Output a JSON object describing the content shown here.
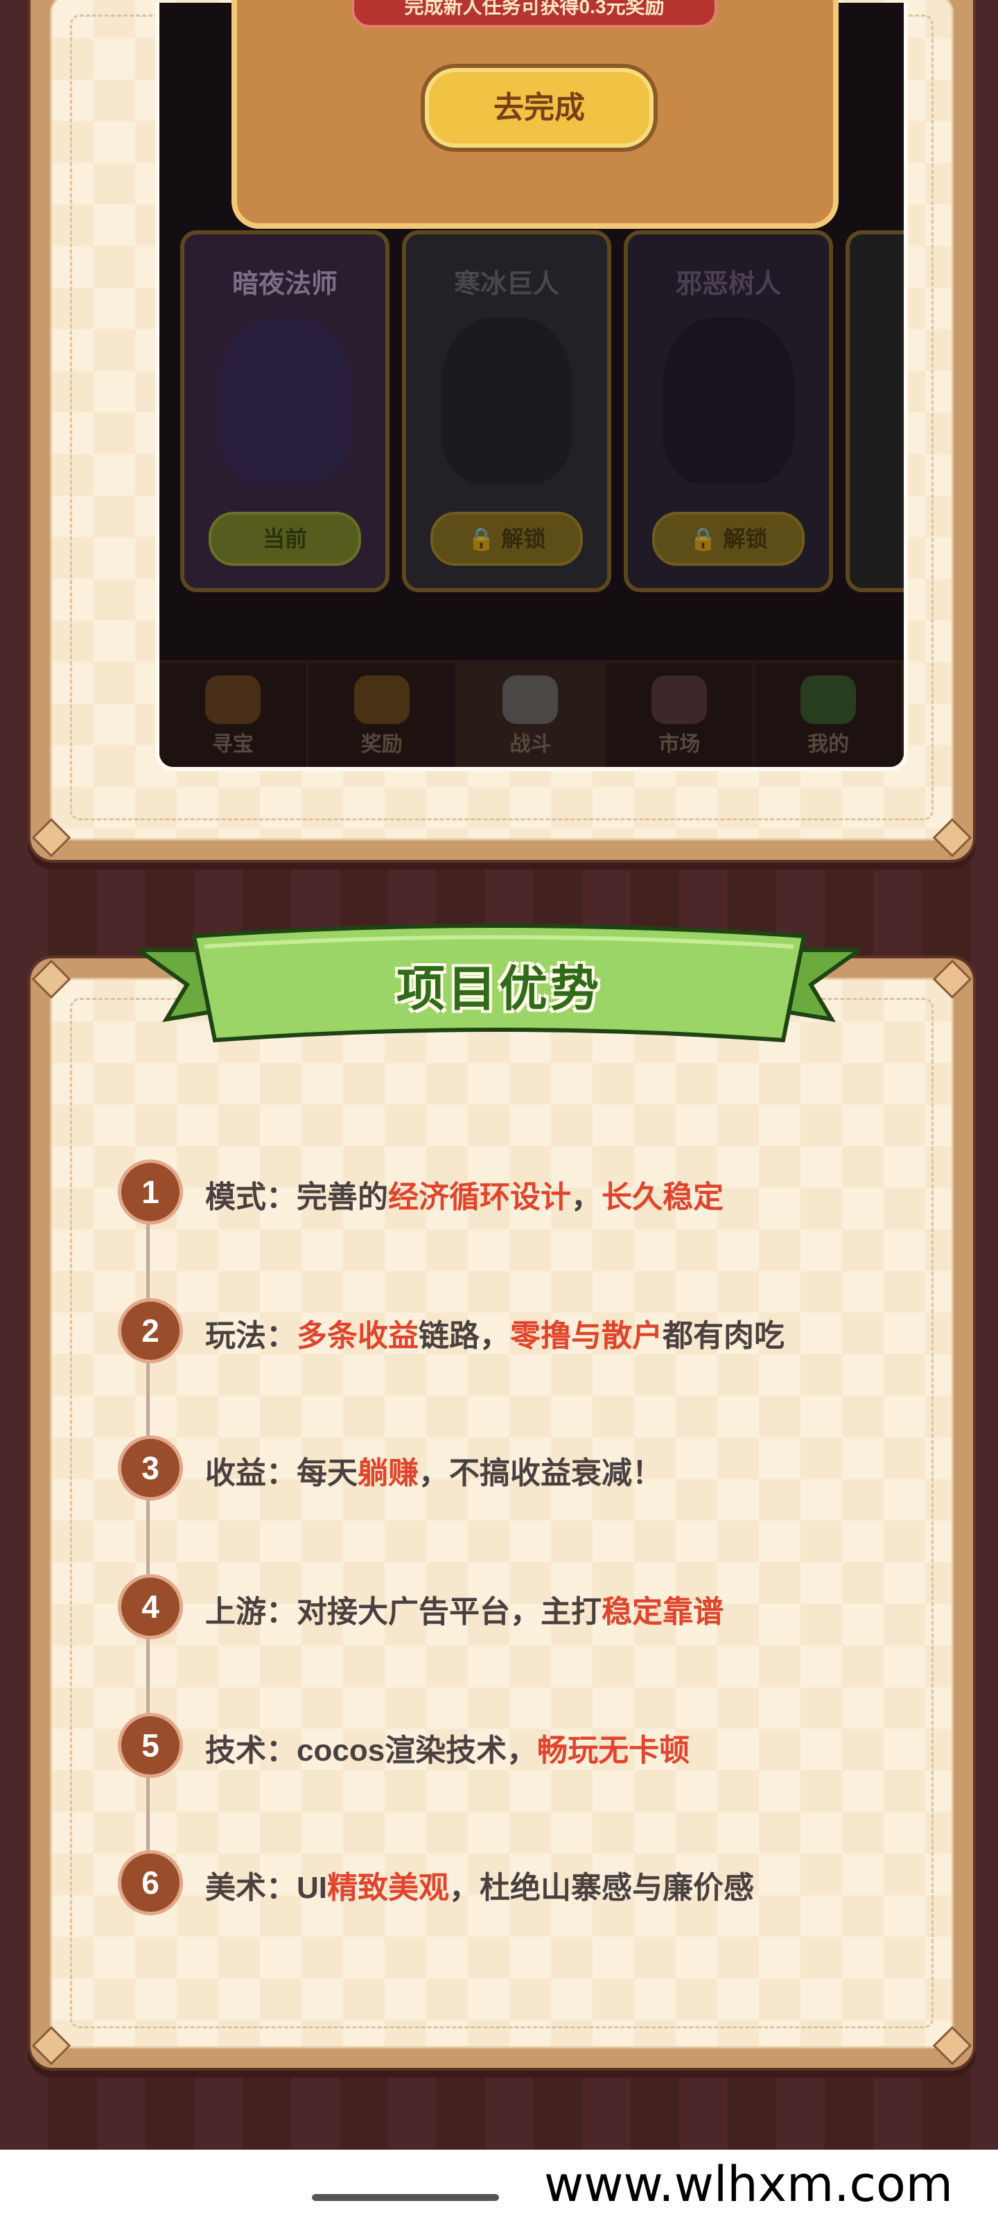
{
  "popup": {
    "tip": "完成新人任务可获得0.3元奖励",
    "button": "去完成"
  },
  "heroes": [
    {
      "name": "暗夜法师",
      "button": "当前"
    },
    {
      "name": "寒冰巨人",
      "button": "解锁"
    },
    {
      "name": "邪恶树人",
      "button": "解锁"
    }
  ],
  "tabs": [
    "寻宝",
    "奖励",
    "战斗",
    "市场",
    "我的"
  ],
  "section": {
    "title": "项目优势"
  },
  "advantages": [
    {
      "num": "1",
      "label": "模式：",
      "parts": [
        "完善的",
        "经济循环设计",
        "，",
        "长久稳定",
        ""
      ]
    },
    {
      "num": "2",
      "label": "玩法：",
      "parts": [
        "",
        "多条收益",
        "链路，",
        "零撸与散户",
        "都有肉吃"
      ]
    },
    {
      "num": "3",
      "label": "收益：",
      "parts": [
        "每天",
        "躺赚",
        "，不搞收益衰减！",
        "",
        ""
      ]
    },
    {
      "num": "4",
      "label": "上游：",
      "parts": [
        "对接大广告平台，主打",
        "稳定靠谱",
        "",
        "",
        ""
      ]
    },
    {
      "num": "5",
      "label": "技术：",
      "parts": [
        "cocos渲染技术，",
        "畅玩无卡顿",
        "",
        "",
        ""
      ]
    },
    {
      "num": "6",
      "label": "美术：",
      "parts": [
        "UI",
        "精致美观",
        "，杜绝山寨感与廉价感",
        "",
        ""
      ]
    }
  ],
  "watermark": "www.wlhxm.com"
}
